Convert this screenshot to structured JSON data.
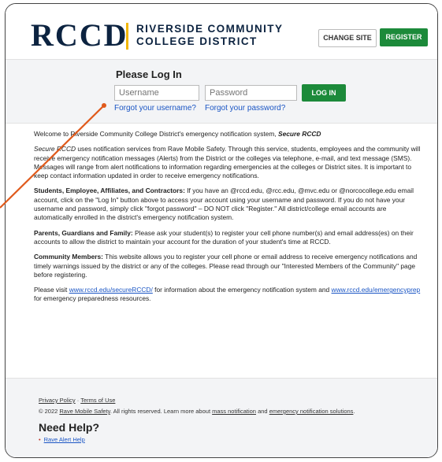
{
  "header": {
    "logo_text": "RCCD",
    "college_line1": "RIVERSIDE COMMUNITY",
    "college_line2": "COLLEGE DISTRICT",
    "change_site_label": "CHANGE SITE",
    "register_label": "REGISTER",
    "accent_color": "#f2b705",
    "brand_color": "#0c2340",
    "button_green": "#1c8a3a"
  },
  "login": {
    "title": "Please Log In",
    "username_placeholder": "Username",
    "password_placeholder": "Password",
    "login_label": "LOG IN",
    "forgot_username": "Forgot your username?",
    "forgot_password": "Forgot your password?"
  },
  "content": {
    "welcome_text": "Welcome to Riverside Community College District's emergency notification system,",
    "welcome_brand": "Secure RCCD",
    "intro_brand": "Secure RCCD",
    "intro_text": "uses notification services from Rave Mobile Safety. Through this service, students, employees and the community will receive emergency notification messages (Alerts) from the District or the colleges via telephone, e-mail, and text message (SMS). Messages will range from alert notifications to information regarding emergencies at the colleges or District sites. It is important to keep contact information updated in order to receive emergency notifications.",
    "students_heading": "Students, Employee, Affiliates, and Contractors:",
    "students_text": "If you have an @rccd.edu, @rcc.edu, @mvc.edu or @norcocollege.edu email account, click on the \"Log In\" button above to access your account using your username and password. If you do not have your username and password, simply click \"forgot password\" – DO NOT click \"Register.\" All district/college email accounts are automatically enrolled in the district's emergency notification system.",
    "parents_heading": "Parents, Guardians and Family:",
    "parents_text": "Please ask your student(s) to register your cell phone number(s) and email address(es) on their accounts to allow the district to maintain your account for the duration of your student's time at RCCD.",
    "community_heading": "Community Members:",
    "community_text": "This website allows you to register your cell phone or email address to receive emergency notifications and timely warnings issued by the district or any of the colleges. Please read through our \"Interested Members of the Community\" page before registering.",
    "visit_prefix": "Please visit",
    "visit_link1": "www.rccd.edu/secureRCCD/",
    "visit_middle": "for information about the emergency notification system and",
    "visit_link2": "www.rccd.edu/emergencyprep",
    "visit_suffix": "for emergency preparedness resources."
  },
  "footer": {
    "privacy_policy": "Privacy Policy",
    "separator": "·",
    "terms_of_use": "Terms of Use",
    "copyright_prefix": "© 2022",
    "rave_link": "Rave Mobile Safety",
    "copyright_middle": ". All rights reserved. Learn more about",
    "mass_notification": "mass notification",
    "and_text": "and",
    "emergency_solutions": "emergency notification solutions",
    "period": ".",
    "need_help": "Need Help?",
    "rave_alert_help": "Rave Alert Help"
  },
  "annotation": {
    "arrow_color": "#e05a1c"
  }
}
